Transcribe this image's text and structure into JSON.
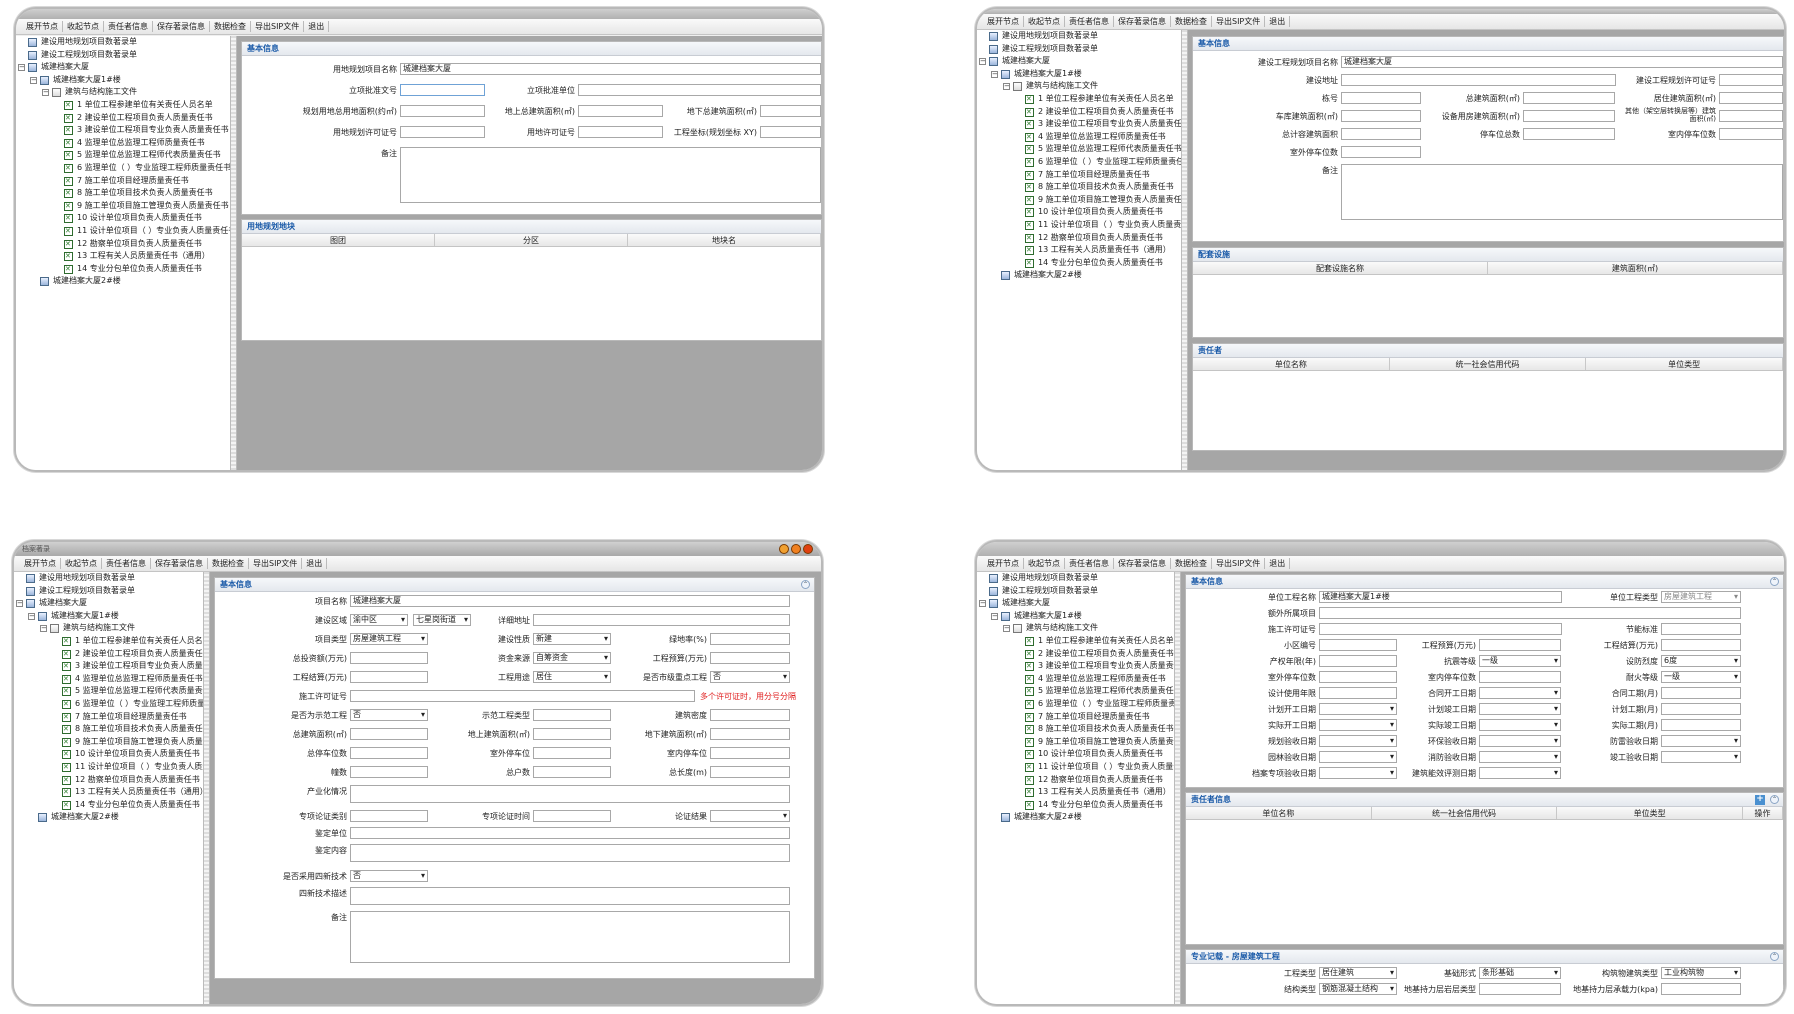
{
  "menu": [
    "展开节点",
    "收起节点",
    "责任者信息",
    "保存著录信息",
    "数据检查",
    "导出SIP文件",
    "退出"
  ],
  "window_title": "档案著录",
  "tree": {
    "root_items": [
      "建设用地规划项目数著录单",
      "建设工程规划项目数著录单",
      "城建档案大厦"
    ],
    "building1": "城建档案大厦1#楼",
    "building2": "城建档案大厦2#楼",
    "folder": "建筑与结构施工文件",
    "docs": [
      "1 单位工程参建单位有关责任人员名单",
      "2 建设单位工程项目负责人质量责任书",
      "3 建设单位工程项目专业负责人质量责任书",
      "4 监理单位总监理工程师质量责任书",
      "5 监理单位总监理工程师代表质量责任书",
      "6 监理单位（   ）专业监理工程师质量责任书",
      "7 施工单位项目经理质量责任书",
      "8 施工单位项目技术负责人质量责任书",
      "9 施工单位项目施工管理负责人质量责任书",
      "10 设计单位项目负责人质量责任书",
      "11 设计单位项目（   ）专业负责人质量责任书",
      "12 勘察单位项目负责人质量责任书",
      "13 工程有关人员质量责任书（通用）",
      "14 专业分包单位负责人质量责任书"
    ]
  },
  "s1": {
    "basic_title": "基本信息",
    "f": {
      "name_label": "用地规划项目名称",
      "name_value": "城建档案大厦",
      "approval_no": "立项批准文号",
      "approval_unit": "立项批准单位",
      "land_area": "规划用地总用地面积(约㎡)",
      "above_area": "地上总建筑面积(㎡)",
      "under_area": "地下总建筑面积(㎡)",
      "permit": "用地规划许可证号",
      "land_permit": "用地许可证号",
      "coord": "工程坐标(规划坐标 XY)",
      "remark": "备注"
    },
    "plot_title": "用地规划地块",
    "plot_cols": [
      "图团",
      "分区",
      "地块名"
    ]
  },
  "s2": {
    "basic_title": "基本信息",
    "f": {
      "name_label": "建设工程规划项目名称",
      "name_value": "城建档案大厦",
      "address": "建设地址",
      "permit": "建设工程规划许可证号",
      "bldg_no": "栋号",
      "total_area": "总建筑面积(㎡)",
      "res_area": "居住建筑面积(㎡)",
      "garage_area": "车库建筑面积(㎡)",
      "equip_area": "设备用房建筑面积(㎡)",
      "other_area": "其他（架空层转换层等）建筑面积(㎡)",
      "capacity": "总计容建筑面积",
      "parking_total": "停车位总数",
      "indoor_parking": "室内停车位数",
      "outdoor_parking": "室外停车位数",
      "remark": "备注"
    },
    "facility_title": "配套设施",
    "facility_cols": [
      "配套设施名称",
      "建筑面积(㎡)"
    ],
    "resp_title": "责任者",
    "resp_cols": [
      "单位名称",
      "统一社会信用代码",
      "单位类型"
    ]
  },
  "s3": {
    "basic_title": "基本信息",
    "f": {
      "proj_name": "项目名称",
      "proj_value": "城建档案大厦",
      "district": "建设区域",
      "district_val": "渝中区",
      "street_val": "七星岗街道",
      "detail_addr": "详细地址",
      "proj_type": "项目类型",
      "proj_type_val": "房屋建筑工程",
      "nature": "建设性质",
      "nature_val": "新建",
      "green": "绿地率(%)",
      "invest": "总投资额(万元)",
      "fund": "资金来源",
      "fund_val": "自筹资金",
      "budget": "工程预算(万元)",
      "settle": "工程结算(万元)",
      "usage": "工程用途",
      "usage_val": "居住",
      "key_proj": "是否市级重点工程",
      "key_proj_val": "否",
      "permit": "施工许可证号",
      "permit_note": "多个许可证时，用分号分隔",
      "demo": "是否为示范工程",
      "demo_val": "否",
      "demo_type": "示范工程类型",
      "density": "建筑密度",
      "total_area": "总建筑面积(㎡)",
      "above_area": "地上建筑面积(㎡)",
      "under_area": "地下建筑面积(㎡)",
      "parking": "总停车位数",
      "outdoor": "室外停车位",
      "indoor": "室内停车位",
      "bldg": "幢数",
      "households": "总户数",
      "length": "总长度(m)",
      "industrial": "产业化情况",
      "review_type": "专项论证类别",
      "review_time": "专项论证时间",
      "review_result": "论证结果",
      "appraise_unit": "鉴定单位",
      "appraise_content": "鉴定内容",
      "new_tech": "是否采用四新技术",
      "new_tech_val": "否",
      "new_tech_desc": "四新技术描述",
      "remark": "备注"
    }
  },
  "s4": {
    "basic_title": "基本信息",
    "f": {
      "unit_name": "单位工程名称",
      "unit_value": "城建档案大厦1#楼",
      "unit_type": "单位工程类型",
      "unit_type_val": "房屋建筑工程",
      "extra_proj": "额外所属项目",
      "permit": "施工许可证号",
      "energy": "节能标准",
      "community": "小区编号",
      "budget": "工程预算(万元)",
      "settle": "工程结算(万元)",
      "years": "产权年限(年)",
      "seismic": "抗震等级",
      "seismic_val": "一级",
      "fortify": "设防烈度",
      "fortify_val": "6度",
      "out_park": "室外停车位数",
      "in_park": "室内停车位数",
      "fire": "耐火等级",
      "fire_val": "一级",
      "design_life": "设计使用年限",
      "contract_start": "合同开工日期",
      "contract_days": "合同工期(月)",
      "plan_start": "计划开工日期",
      "plan_end": "计划竣工日期",
      "plan_days": "计划工期(月)",
      "real_start": "实际开工日期",
      "real_end": "实际竣工日期",
      "real_days": "实际工期(月)",
      "plan_accept": "规划验收日期",
      "env_accept": "环保验收日期",
      "air_accept": "防雷验收日期",
      "garden_accept": "园林验收日期",
      "fire_accept": "消防验收日期",
      "complete_accept": "竣工验收日期",
      "archive_accept": "档案专项验收日期",
      "energy_eval": "建筑能效评测日期"
    },
    "resp_title": "责任者信息",
    "resp_cols": [
      "单位名称",
      "统一社会信用代码",
      "单位类型",
      "操作"
    ],
    "spec_title": "专业记载 - 房屋建筑工程",
    "spec": {
      "eng_type": "工程类型",
      "eng_type_val": "居住建筑",
      "foundation": "基础形式",
      "foundation_val": "条形基础",
      "struct_type": "构筑物建筑类型",
      "struct_type_val": "工业构筑物",
      "struct": "结构类型",
      "struct_val": "钢筋混凝土结构",
      "bearing_layer": "地基持力层岩层类型",
      "bearing_force": "地基持力层承载力(kpa)"
    }
  }
}
